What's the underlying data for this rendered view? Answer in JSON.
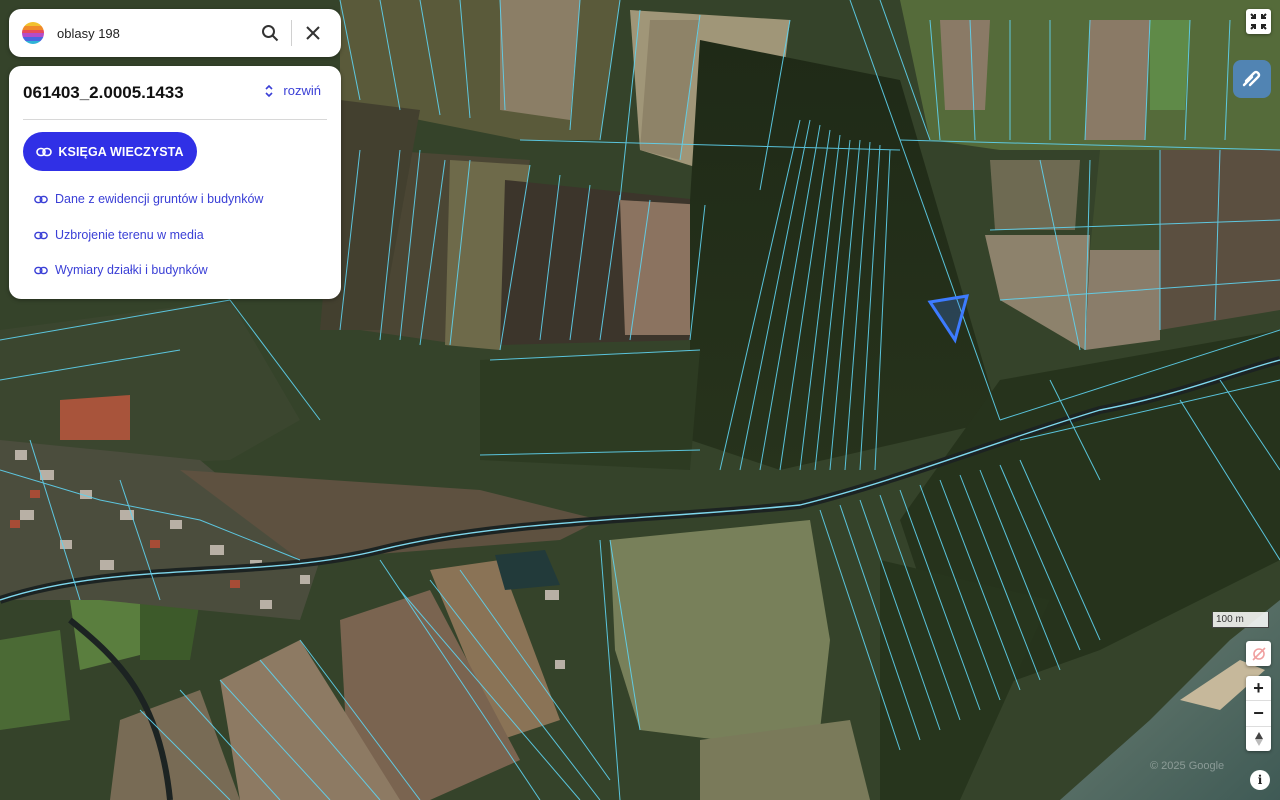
{
  "search": {
    "value": "oblasy 198",
    "search_icon": "search-icon",
    "close_icon": "close-icon"
  },
  "parcel": {
    "id": "061403_2.0005.1433",
    "expand_label": "rozwiń",
    "primary_button": "KSIĘGA WIECZYSTA",
    "links": [
      "Dane z ewidencji gruntów i budynków",
      "Uzbrojenie terenu w media",
      "Wymiary działki i budynków"
    ]
  },
  "map": {
    "scale_label": "100 m",
    "attribution": "© 2025 Google",
    "parcel_line_color": "#5fd3f0",
    "selected_parcel_color": "#3d7bff"
  },
  "controls": {
    "fullscreen": "fullscreen-exit-icon",
    "layers": "layers-icon",
    "location": "location-off-icon",
    "zoom_in": "+",
    "zoom_out": "−",
    "compass": "compass-icon",
    "info": "i"
  },
  "colors": {
    "accent": "#3030e6",
    "link": "#3a3fd6"
  }
}
